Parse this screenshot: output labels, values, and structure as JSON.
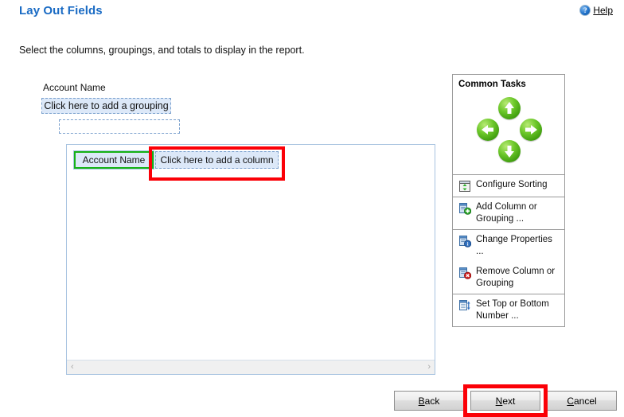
{
  "header": {
    "title": "Lay Out Fields",
    "help_label": "Help",
    "help_icon": "question-mark-circle-icon"
  },
  "subtitle": "Select the columns, groupings, and totals to display in the report.",
  "grouping": {
    "label": "Account Name",
    "drop_zone_label": "Click here to add a grouping",
    "empty_zone_label": ""
  },
  "report_surface": {
    "columns": [
      {
        "label": "Account Name",
        "state": "selected"
      },
      {
        "label": "Click here to add a column",
        "state": "placeholder"
      }
    ],
    "scrollbar": {
      "left_arrow": "‹",
      "right_arrow": "›"
    }
  },
  "common_tasks": {
    "title": "Common Tasks",
    "nav_buttons": [
      {
        "name": "move-up",
        "icon": "arrow-up-icon"
      },
      {
        "name": "move-left",
        "icon": "arrow-left-icon"
      },
      {
        "name": "move-right",
        "icon": "arrow-right-icon"
      },
      {
        "name": "move-down",
        "icon": "arrow-down-icon"
      }
    ],
    "items": [
      {
        "label": "Configure Sorting",
        "icon": "sort-updown-icon"
      },
      {
        "label": "Add Column or Grouping ...",
        "icon": "document-add-icon"
      },
      {
        "label": "Change Properties ...",
        "icon": "document-info-icon"
      },
      {
        "label": "Remove Column or Grouping",
        "icon": "document-remove-icon"
      },
      {
        "label": "Set Top or Bottom Number ...",
        "icon": "document-topbottom-icon"
      }
    ]
  },
  "footer": {
    "buttons": [
      {
        "name": "back",
        "accel": "B",
        "rest": "ack",
        "highlighted": false
      },
      {
        "name": "next",
        "accel": "N",
        "rest": "ext",
        "highlighted": true
      },
      {
        "name": "cancel",
        "accel": "C",
        "rest": "ancel",
        "highlighted": false
      }
    ]
  },
  "colors": {
    "title_blue": "#1a6bc4",
    "highlight_red": "#fb0007",
    "selected_green": "#16b216",
    "dropzone_blue_fill": "#dce8f8",
    "dropzone_blue_border": "#7aa0cd",
    "panel_border": "#9a9a9a",
    "surface_border": "#a8c3e0"
  }
}
